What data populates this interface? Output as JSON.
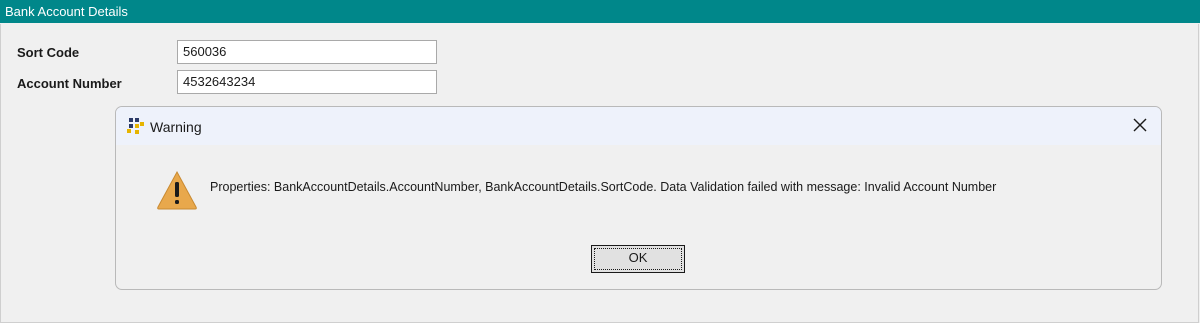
{
  "window": {
    "title": "Bank Account Details"
  },
  "form": {
    "sort_code_label": "Sort Code",
    "sort_code_value": "560036",
    "account_number_label": "Account Number",
    "account_number_value": "4532643234"
  },
  "dialog": {
    "title": "Warning",
    "message": "Properties: BankAccountDetails.AccountNumber, BankAccountDetails.SortCode. Data Validation failed with message: Invalid Account Number",
    "ok_label": "OK",
    "icons": {
      "app": "app-logo-icon",
      "warning": "warning-icon",
      "close": "close-icon"
    }
  },
  "colors": {
    "titlebar": "#00878a",
    "dialog_header": "#eef2fb",
    "warning_fill": "#e8a84c"
  }
}
